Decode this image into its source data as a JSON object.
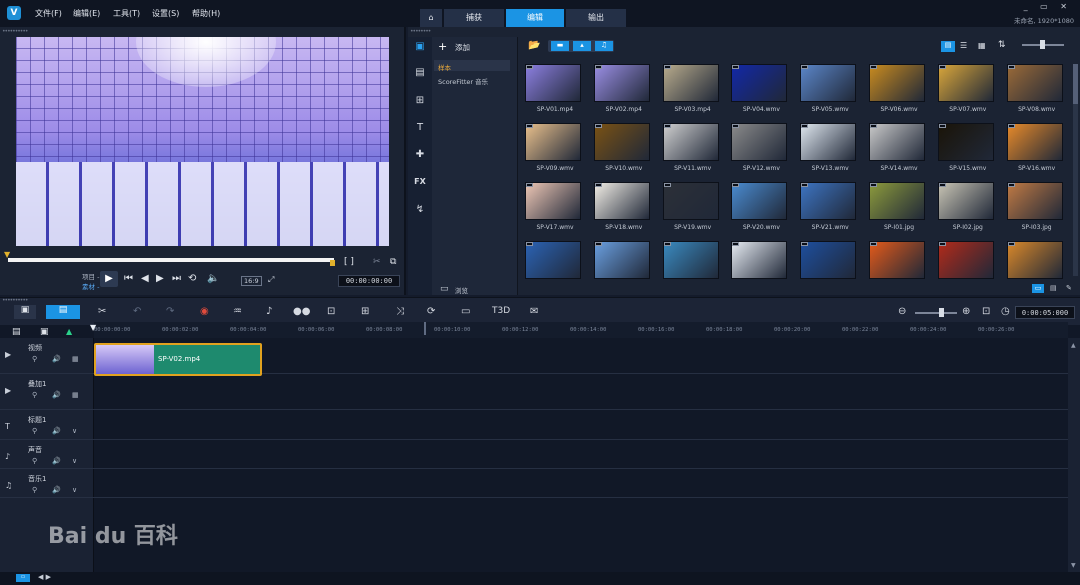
{
  "app": {
    "logo": "V",
    "project_label": "未命名, 1920*1080"
  },
  "menu": [
    "文件(F)",
    "编辑(E)",
    "工具(T)",
    "设置(S)",
    "帮助(H)"
  ],
  "tabs": {
    "home_icon": "home-icon",
    "capture": "捕获",
    "edit": "编辑",
    "share": "输出"
  },
  "window_controls": "_ ▭ ✕",
  "player": {
    "mode_project": "项目 -",
    "mode_clip": "素材 -",
    "zoom": "16:9",
    "timecode": "00:00:00:00",
    "markers": "[ ]"
  },
  "library": {
    "add_label": "添加",
    "folders": [
      "样本",
      "ScoreFitter 音乐"
    ],
    "browse_label": "浏览",
    "thumbnails": [
      {
        "name": "SP-V01.mp4",
        "color": "#8c7fe0"
      },
      {
        "name": "SP-V02.mp4",
        "color": "#9a8ee4"
      },
      {
        "name": "SP-V03.mp4",
        "color": "#b8ab8c"
      },
      {
        "name": "SP-V04.wmv",
        "color": "#1228a8"
      },
      {
        "name": "SP-V05.wmv",
        "color": "#5b86c9"
      },
      {
        "name": "SP-V06.wmv",
        "color": "#c98b1f"
      },
      {
        "name": "SP-V07.wmv",
        "color": "#d9a63a"
      },
      {
        "name": "SP-V08.wmv",
        "color": "#9a6a38"
      },
      {
        "name": "SP-V09.wmv",
        "color": "#e9c08c"
      },
      {
        "name": "SP-V10.wmv",
        "color": "#7a5214"
      },
      {
        "name": "SP-V11.wmv",
        "color": "#cfcfcf"
      },
      {
        "name": "SP-V12.wmv",
        "color": "#8a8a8a"
      },
      {
        "name": "SP-V13.wmv",
        "color": "#dfe7ef"
      },
      {
        "name": "SP-V14.wmv",
        "color": "#c9c9c9"
      },
      {
        "name": "SP-V15.wmv",
        "color": "#1a1408"
      },
      {
        "name": "SP-V16.wmv",
        "color": "#e78a2a"
      },
      {
        "name": "SP-V17.wmv",
        "color": "#eec7b5"
      },
      {
        "name": "SP-V18.wmv",
        "color": "#f2eee6"
      },
      {
        "name": "SP-V19.wmv",
        "color": "#2c3038"
      },
      {
        "name": "SP-V20.wmv",
        "color": "#4a8bd0"
      },
      {
        "name": "SP-V21.wmv",
        "color": "#3d74c2"
      },
      {
        "name": "SP-I01.jpg",
        "color": "#8c9a3c"
      },
      {
        "name": "SP-I02.jpg",
        "color": "#c8c4b4"
      },
      {
        "name": "SP-I03.jpg",
        "color": "#c07a44"
      },
      {
        "name": "",
        "color": "#2b63b4"
      },
      {
        "name": "",
        "color": "#6a9fe0"
      },
      {
        "name": "",
        "color": "#3a8ac0"
      },
      {
        "name": "",
        "color": "#e6ebf2"
      },
      {
        "name": "",
        "color": "#1e4f9e"
      },
      {
        "name": "",
        "color": "#e35a1a"
      },
      {
        "name": "",
        "color": "#b22a1a"
      },
      {
        "name": "",
        "color": "#d9882a"
      }
    ]
  },
  "timeline": {
    "total_time": "0:00:05:000",
    "ruler": [
      "00:00:00:00",
      "00:00:02:00",
      "00:00:04:00",
      "00:00:06:00",
      "00:00:08:00",
      "00:00:10:00",
      "00:00:12:00",
      "00:00:14:00",
      "00:00:16:00",
      "00:00:18:00",
      "00:00:20:00",
      "00:00:22:00",
      "00:00:24:00",
      "00:00:26:00"
    ],
    "tracks": [
      {
        "name": "视频",
        "icon": "video-track-icon"
      },
      {
        "name": "叠加1",
        "icon": "overlay-track-icon"
      },
      {
        "name": "标题1",
        "icon": "title-track-icon"
      },
      {
        "name": "声音",
        "icon": "voice-track-icon"
      },
      {
        "name": "音乐1",
        "icon": "music-track-icon"
      }
    ],
    "clip": {
      "name": "SP-V02.mp4"
    }
  },
  "watermark": "Bai du 百科"
}
